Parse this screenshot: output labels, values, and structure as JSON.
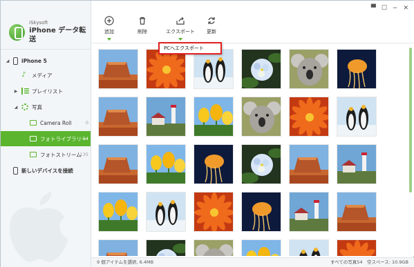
{
  "app": {
    "brand_small": "iSkysoft",
    "brand_title": "iPhone データ転送"
  },
  "sidebar": {
    "device": "iPhone 5",
    "media": "メディア",
    "playlist": "プレイリスト",
    "photos": "写真",
    "camera_roll": {
      "label": "Camera Roll",
      "count": "0"
    },
    "photo_library": {
      "label": "フォトライブラリー",
      "count": "54"
    },
    "photo_stream": {
      "label": "フォトストリーム",
      "count": "135"
    },
    "connect_new": "新しいデバイスを接続"
  },
  "toolbar": {
    "add": "追加",
    "delete": "削除",
    "export": "エクスポート",
    "refresh": "更新"
  },
  "export_menu": {
    "export_to_pc": "PCへエクスポート"
  },
  "window_controls": [
    "message-icon",
    "feedback-icon",
    "minimize-icon",
    "close-icon"
  ],
  "photos": [
    "canyon",
    "flower",
    "penguins",
    "hydrangea",
    "koala",
    "jellyfish",
    "canyon",
    "lighthouse",
    "tulips",
    "koala",
    "flower",
    "penguins",
    "canyon",
    "tulips",
    "jellyfish",
    "hydrangea",
    "canyon",
    "lighthouse",
    "tulips",
    "penguins",
    "flower",
    "jellyfish",
    "lighthouse",
    "canyon",
    "canyon",
    "hydrangea",
    "koala",
    "tulips",
    "penguins",
    "flower"
  ],
  "status": {
    "selected": "9 個アイテムを選択, 6.4MB",
    "summary": "すべての写真54　空スペース: 10.9GB"
  },
  "colors": {
    "accent": "#5bb52f",
    "highlight_border": "#e02020"
  }
}
